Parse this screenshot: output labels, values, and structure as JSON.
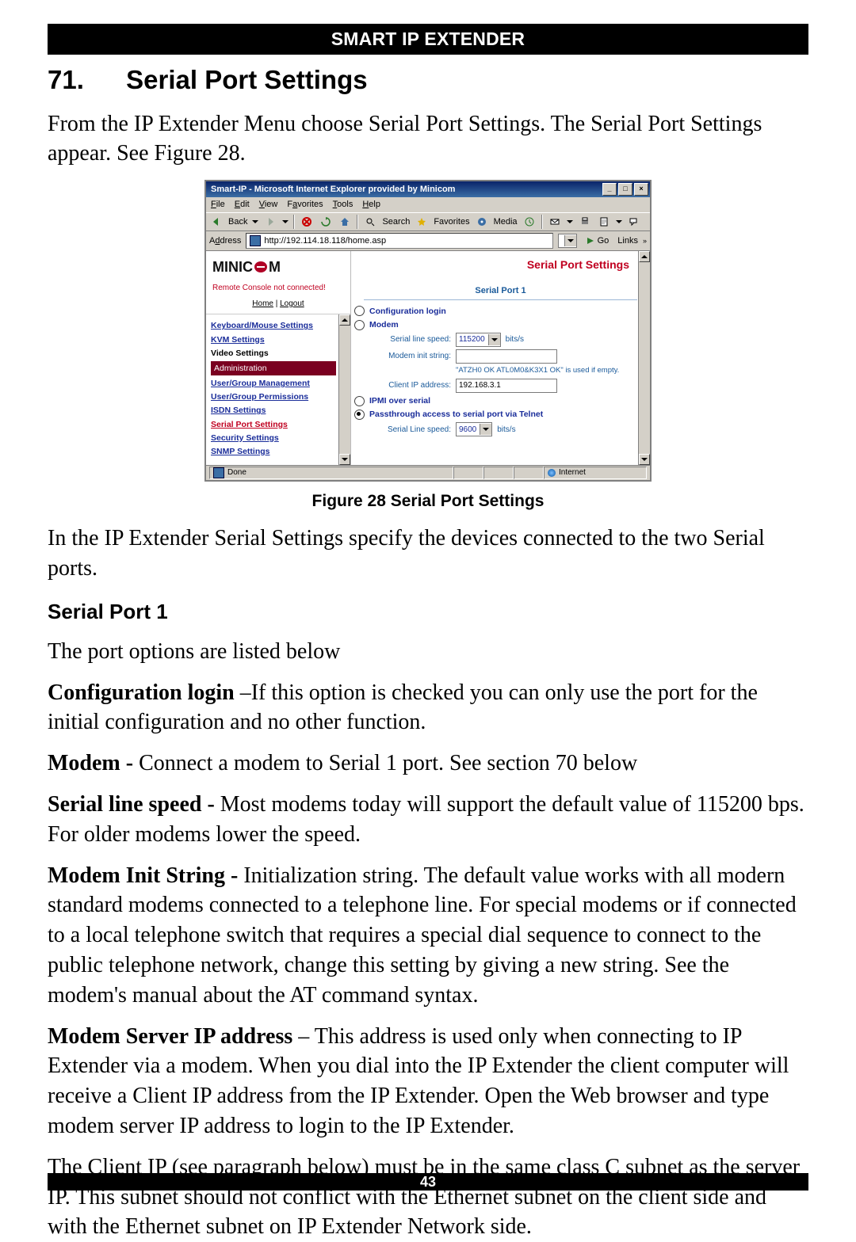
{
  "banner": "SMART IP EXTENDER",
  "heading_number": "71.",
  "heading_text": "Serial Port Settings",
  "intro": "From the IP Extender Menu choose Serial Port Settings. The Serial Port Settings appear. See Figure 28.",
  "figure_caption": "Figure 28 Serial Port Settings",
  "after_figure": "In the IP Extender Serial Settings specify the devices connected to the two Serial ports.",
  "sub_heading": "Serial Port 1",
  "sp1_intro": "The port options are listed below",
  "cfg_login_label": "Configuration login",
  "cfg_login_text": " –If this option is checked you can only use the port for the initial configuration and no other function.",
  "modem_label": "Modem - ",
  "modem_text": "Connect a modem to Serial 1 port. See section 70 below",
  "sls_label": "Serial line speed - ",
  "sls_text": "Most modems today will support the default value of 115200 bps. For older modems lower the speed.",
  "mis_label": "Modem Init String - ",
  "mis_text": "Initialization string. The default value works with all modern standard modems connected to a telephone line. For special modems or if connected to a local telephone switch that requires a special dial sequence to connect to the public telephone network, change this setting by giving a new string. See the modem's manual about the AT command syntax.",
  "msip_label": "Modem Server IP address",
  "msip_text": " – This address is used only when connecting to IP Extender via a modem. When you dial into the IP Extender the client computer will receive a Client IP address from the IP Extender. Open the Web browser and type modem server IP address to login to the IP Extender.",
  "client_ip_text": "The Client IP (see paragraph below) must be in the same class C subnet as the server IP. This subnet should not conflict with the Ethernet subnet on the client side and with the Ethernet subnet on IP Extender Network side.",
  "page_number": "43",
  "app": {
    "window_title": "Smart-IP - Microsoft Internet Explorer provided by Minicom",
    "menu": {
      "file": "File",
      "edit": "Edit",
      "view": "View",
      "favorites": "Favorites",
      "tools": "Tools",
      "help": "Help"
    },
    "toolbar": {
      "back": "Back",
      "search": "Search",
      "favorites": "Favorites",
      "media": "Media"
    },
    "address_label": "Address",
    "address_value": "http://192.114.18.118/home.asp",
    "go": "Go",
    "links": "Links",
    "brand": "MINIC    M",
    "no_connection": "Remote Console not connected!",
    "home": "Home",
    "logout": "Logout",
    "nav": {
      "km": "Keyboard/Mouse Settings",
      "kvm": "KVM Settings",
      "video": "Video Settings",
      "admin": "Administration",
      "ugm": "User/Group Management",
      "ugp": "User/Group Permissions",
      "isdn": "ISDN Settings",
      "serial": "Serial Port Settings",
      "security": "Security Settings",
      "snmp": "SNMP Settings"
    },
    "main": {
      "title": "Serial Port Settings",
      "group1": "Serial Port 1",
      "cfg_login": "Configuration login",
      "modem": "Modem",
      "sls_label": "Serial line speed:",
      "sls_value": "115200",
      "bits": "bits/s",
      "mis_label": "Modem init string:",
      "mis_hint": "\"ATZH0 OK ATL0M0&K3X1 OK\" is used if empty.",
      "cip_label": "Client IP address:",
      "cip_value": "192.168.3.1",
      "ipmi": "IPMI over serial",
      "pass": "Passthrough access to serial port via Telnet",
      "sls2_label": "Serial Line speed:",
      "sls2_value": "9600"
    },
    "status": {
      "done": "Done",
      "internet": "Internet"
    }
  }
}
